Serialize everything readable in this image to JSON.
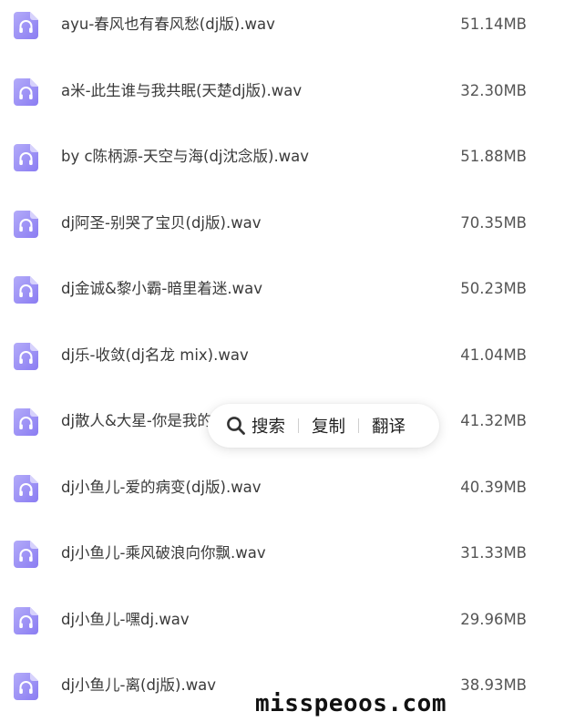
{
  "files": [
    {
      "name": "ayu-春风也有春风愁(dj版).wav",
      "size": "51.14MB",
      "icon": "headphones-icon"
    },
    {
      "name": "a米-此生谁与我共眠(天楚dj版).wav",
      "size": "32.30MB",
      "icon": "headphones-icon"
    },
    {
      "name": "by c陈柄源-天空与海(dj沈念版).wav",
      "size": "51.88MB",
      "icon": "headphones-icon"
    },
    {
      "name": "dj阿圣-别哭了宝贝(dj版).wav",
      "size": "70.35MB",
      "icon": "headphones-icon"
    },
    {
      "name": "dj金诚&黎小霸-暗里着迷.wav",
      "size": "50.23MB",
      "icon": "headphones-icon"
    },
    {
      "name": "dj乐-收敛(dj名龙 mix).wav",
      "size": "41.04MB",
      "icon": "headphones-icon"
    },
    {
      "name": "dj散人&大星-你是我的",
      "size": "41.32MB",
      "icon": "headphones-icon"
    },
    {
      "name": "dj小鱼儿-爱的病变(dj版).wav",
      "size": "40.39MB",
      "icon": "headphones-icon"
    },
    {
      "name": "dj小鱼儿-乘风破浪向你飘.wav",
      "size": "31.33MB",
      "icon": "headphones-icon"
    },
    {
      "name": "dj小鱼儿-嘿dj.wav",
      "size": "29.96MB",
      "icon": "headphones-icon"
    },
    {
      "name": "dj小鱼儿-离(dj版).wav",
      "size": "38.93MB",
      "icon": "headphones-icon"
    }
  ],
  "popup": {
    "search_label": "搜索",
    "copy_label": "复制",
    "translate_label": "翻译",
    "search_icon": "search-icon"
  },
  "watermark": "misspeoos.com",
  "colors": {
    "icon_light": "#b3abf9",
    "icon_dark": "#8a7cf2",
    "icon_glyph": "#ffffff",
    "text": "#3a3a3a",
    "size_text": "#555555"
  }
}
